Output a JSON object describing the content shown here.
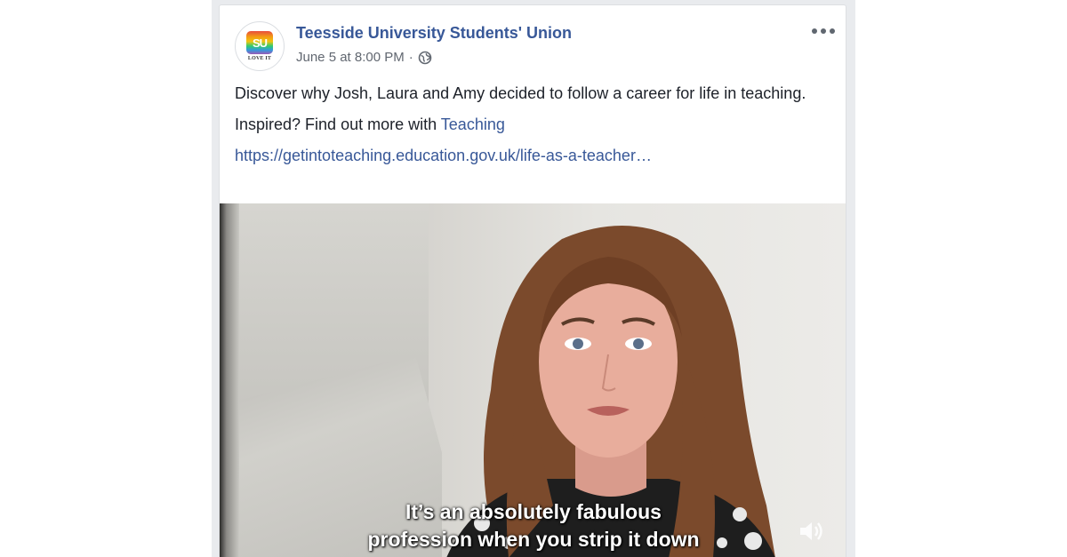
{
  "post": {
    "page_name": "Teesside University Students' Union",
    "timestamp": "June 5 at 8:00 PM",
    "meta_separator": "·",
    "privacy_icon": "globe-icon",
    "avatar": {
      "logo_mark": "SU",
      "logo_text": "LOVE IT"
    },
    "text_line_1": "Discover why Josh, Laura and Amy decided to follow a career for life in teaching.",
    "text_line_2_prefix": "Inspired? Find out more with ",
    "text_line_2_link": "Teaching",
    "link_url": "https://getintoteaching.education.gov.uk/life-as-a-teacher…",
    "more_icon": "ellipsis-icon"
  },
  "video": {
    "subtitle_line_1": "It’s an absolutely fabulous",
    "subtitle_line_2": "profession when you strip it down",
    "volume_icon": "volume-icon"
  },
  "colors": {
    "link": "#385898",
    "text": "#1d2129",
    "meta": "#616770",
    "feed_background": "#e9ebee"
  }
}
